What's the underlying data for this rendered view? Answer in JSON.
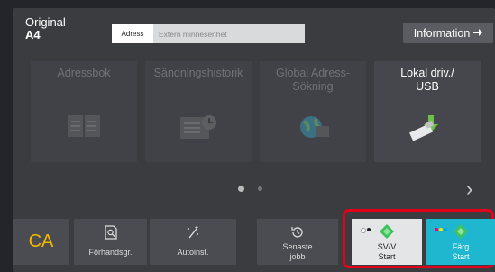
{
  "header": {
    "original_label": "Original",
    "original_size": "A4",
    "address_label": "Adress",
    "address_placeholder": "Extern minnesenhet",
    "information_label": "Information"
  },
  "tiles": [
    {
      "label": "Adressbok",
      "icon": "address-book-icon"
    },
    {
      "label": "Sändningshistorik",
      "icon": "history-list-icon"
    },
    {
      "label": "Global Adress-\nSökning",
      "icon": "globe-icon"
    },
    {
      "label": "Lokal driv./\nUSB",
      "icon": "usb-drive-icon"
    }
  ],
  "bottom": {
    "ca_label": "CA",
    "preview_label": "Förhandsgr.",
    "auto_label": "Autoinst.",
    "recent_label": "Senaste\njobb",
    "bw_start_label": "SV/V\nStart",
    "color_start_label": "Färg\nStart"
  },
  "colors": {
    "ca_text": "#f2b800",
    "color_start_bg": "#1fb6cf",
    "highlight_border": "#e2001a",
    "start_gem": "#3ec35c"
  }
}
